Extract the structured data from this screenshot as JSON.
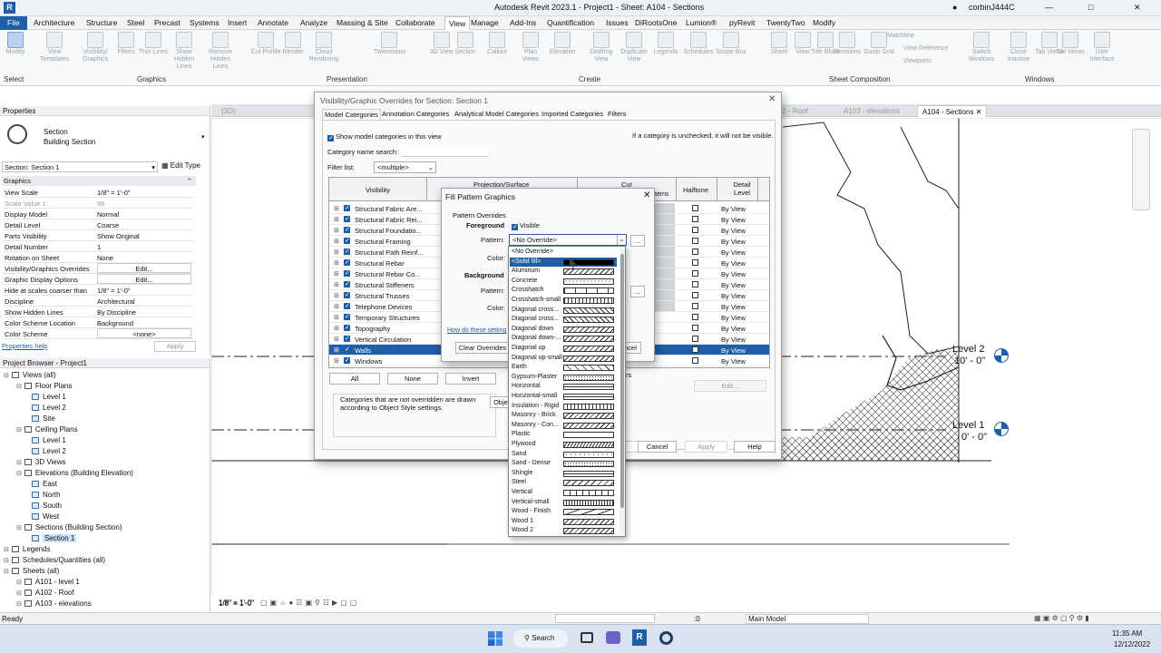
{
  "window_title": "Autodesk Revit 2023.1 - Project1 - Sheet: A104 - Sections",
  "user": "corbinJ444C",
  "menu": [
    "File",
    "Architecture",
    "Structure",
    "Steel",
    "Precast",
    "Systems",
    "Insert",
    "Annotate",
    "Analyze",
    "Massing & Site",
    "Collaborate",
    "View",
    "Manage",
    "Add-Ins",
    "Quantification",
    "Issues",
    "DiRootsOne",
    "Lumion®",
    "pyRevit",
    "TwentyTwo",
    "Modify"
  ],
  "active_menu": "View",
  "ribbon": {
    "buttons": [
      "Modify",
      "View Templates",
      "Visibility/ Graphics",
      "Filters",
      "Thin Lines",
      "Show Hidden Lines",
      "Remove Hidden Lines",
      "Cut Profile",
      "Render",
      "Cloud Rendering",
      "Twinmotion",
      "3D View",
      "Section",
      "Callout",
      "Plan Views",
      "Elevation",
      "Drafting View",
      "Duplicate View",
      "Legends",
      "Schedules",
      "Scope Box",
      "Sheet",
      "View",
      "Title Block",
      "Revisions",
      "Guide Grid",
      "Matchline",
      "View Reference",
      "Viewports",
      "Switch Windows",
      "Close Inactive",
      "Tab Views",
      "Tile Views",
      "User Interface"
    ],
    "groups": [
      "Select",
      "Graphics",
      "Presentation",
      "Create",
      "Sheet Composition",
      "Windows"
    ]
  },
  "properties": {
    "title": "Properties",
    "type_name": "Section",
    "type_sub": "Building Section",
    "selector": "Section: Section 1",
    "edit_type": "Edit Type",
    "section_header": "Graphics",
    "rows": [
      {
        "k": "View Scale",
        "v": "1/8\" = 1'-0\""
      },
      {
        "k": "Scale Value    1:",
        "v": "96"
      },
      {
        "k": "Display Model",
        "v": "Normal"
      },
      {
        "k": "Detail Level",
        "v": "Coarse"
      },
      {
        "k": "Parts Visibility",
        "v": "Show Original"
      },
      {
        "k": "Detail Number",
        "v": "1"
      },
      {
        "k": "Rotation on Sheet",
        "v": "None"
      },
      {
        "k": "Visibility/Graphics Overrides",
        "v": "Edit..."
      },
      {
        "k": "Graphic Display Options",
        "v": "Edit..."
      },
      {
        "k": "Hide at scales coarser than",
        "v": "1/8\" = 1'-0\""
      },
      {
        "k": "Discipline",
        "v": "Architectural"
      },
      {
        "k": "Show Hidden Lines",
        "v": "By Discipline"
      },
      {
        "k": "Color Scheme Location",
        "v": "Background"
      },
      {
        "k": "Color Scheme",
        "v": "<none>"
      }
    ],
    "help": "Properties help",
    "apply": "Apply"
  },
  "browser": {
    "title": "Project Browser - Project1",
    "items": [
      {
        "t": "Views (all)",
        "lvl": 0
      },
      {
        "t": "Floor Plans",
        "lvl": 1
      },
      {
        "t": "Level 1",
        "lvl": 2
      },
      {
        "t": "Level 2",
        "lvl": 2
      },
      {
        "t": "Site",
        "lvl": 2
      },
      {
        "t": "Ceiling Plans",
        "lvl": 1
      },
      {
        "t": "Level 1",
        "lvl": 2
      },
      {
        "t": "Level 2",
        "lvl": 2
      },
      {
        "t": "3D Views",
        "lvl": 1
      },
      {
        "t": "Elevations (Building Elevation)",
        "lvl": 1
      },
      {
        "t": "East",
        "lvl": 2
      },
      {
        "t": "North",
        "lvl": 2
      },
      {
        "t": "South",
        "lvl": 2
      },
      {
        "t": "West",
        "lvl": 2
      },
      {
        "t": "Sections (Building Section)",
        "lvl": 1
      },
      {
        "t": "Section 1",
        "lvl": 2
      },
      {
        "t": "Legends",
        "lvl": 0
      },
      {
        "t": "Schedules/Quantities (all)",
        "lvl": 0
      },
      {
        "t": "Sheets (all)",
        "lvl": 0
      },
      {
        "t": "A101 - level 1",
        "lvl": 1
      },
      {
        "t": "A102 - Roof",
        "lvl": 1
      },
      {
        "t": "A103 - elevations",
        "lvl": 1
      }
    ]
  },
  "view_tabs": [
    {
      "label": "{3D}",
      "active": false
    },
    {
      "label": "A102 - Roof",
      "active": false
    },
    {
      "label": "A103 - elevations",
      "active": false
    },
    {
      "label": "A104 - Sections",
      "active": true
    }
  ],
  "levels": [
    {
      "name": "Level 2",
      "elev": "10' - 0\""
    },
    {
      "name": "Level 1",
      "elev": "0' - 0\""
    }
  ],
  "vg_dialog": {
    "title": "Visibility/Graphic Overrides for Section: Section 1",
    "tabs": [
      "Model Categories",
      "Annotation Categories",
      "Analytical Model Categories",
      "Imported Categories",
      "Filters"
    ],
    "show_model": "Show model categories in this view",
    "note": "If a category is unchecked, it will not be visible.",
    "search_label": "Category name search:",
    "filter_label": "Filter list:",
    "filter_value": "<multiple>",
    "headers": {
      "visibility": "Visibility",
      "proj": "Projection/Surface",
      "cut": "Cut",
      "halftone": "Halftone",
      "detail": "Detail Level",
      "patterns": "terns"
    },
    "rows": [
      "Structural Fabric Are...",
      "Structural Fabric Rei...",
      "Structural Foundatio...",
      "Structural Framing",
      "Structural Path Reinf...",
      "Structural Rebar",
      "Structural Rebar Co...",
      "Structural Stiffeners",
      "Structural Trusses",
      "Telephone Devices",
      "Temporary Structures",
      "Topography",
      "Vertical Circulation",
      "Walls",
      "Windows"
    ],
    "detail_value": "By View",
    "selected_row": "Walls",
    "buttons": {
      "all": "All",
      "none": "None",
      "invert": "Invert",
      "cancel": "Cancel",
      "apply": "Apply",
      "help": "Help",
      "edit": "Edit...",
      "cancel2": "ncel",
      "ers": "ers",
      "obj": "Obje"
    },
    "footer_note": "Categories that are not overridden are drawn according to Object Style settings."
  },
  "fill_dialog": {
    "title": "Fill Pattern Graphics",
    "section": "Pattern Overrides",
    "foreground": "Foreground",
    "visible": "Visible",
    "pattern_label": "Pattern:",
    "pattern_value": "<No Override>",
    "color_label": "Color:",
    "background": "Background",
    "link": "How do these setting",
    "clear": "Clear Overrides",
    "more": "..."
  },
  "pattern_list": [
    "<No Override>",
    "<Solid fill>",
    "Aluminum",
    "Concrete",
    "Crosshatch",
    "Crosshatch-small",
    "Diagonal cross...",
    "Diagonal cross...",
    "Diagonal down",
    "Diagonal down-...",
    "Diagonal up",
    "Diagonal up-small",
    "Earth",
    "Gypsum-Plaster",
    "Horizontal",
    "Horizontal-small",
    "Insulation - Rigid",
    "Masonry - Brick",
    "Masonry - Con...",
    "Plastic",
    "Plywood",
    "Sand",
    "Sand - Dense",
    "Shingle",
    "Steel",
    "Vertical",
    "Vertical-small",
    "Wood - Finish",
    "Wood 1",
    "Wood 2"
  ],
  "pattern_selected": "<Solid fill>",
  "view_scale_bar": "1/8\" = 1'-0\"",
  "status": {
    "left": "Ready",
    "zero": ":0",
    "model": "Main Model"
  },
  "taskbar": {
    "search": "Search",
    "time": "11:35 AM",
    "date": "12/12/2022"
  }
}
